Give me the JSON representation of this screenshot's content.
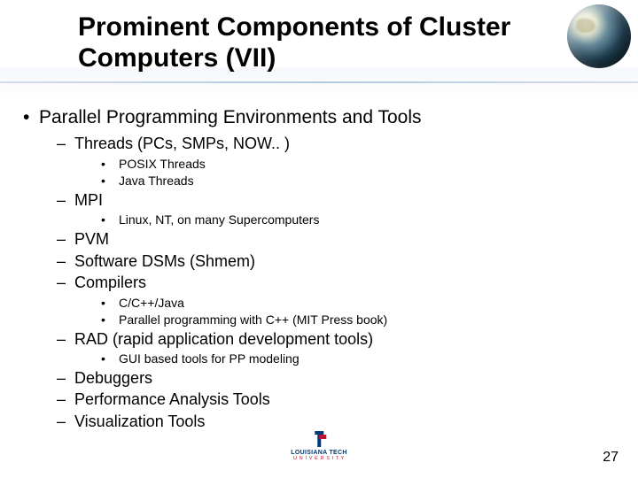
{
  "title": "Prominent Components of Cluster Computers (VII)",
  "content": {
    "heading": "Parallel Programming Environments and Tools",
    "items": [
      {
        "label": "Threads (PCs, SMPs, NOW.. )",
        "sub": [
          "POSIX Threads",
          "Java Threads"
        ]
      },
      {
        "label": "MPI",
        "sub": [
          "Linux, NT, on many Supercomputers"
        ]
      },
      {
        "label": "PVM",
        "sub": []
      },
      {
        "label": "Software DSMs (Shmem)",
        "sub": []
      },
      {
        "label": "Compilers",
        "sub": [
          "C/C++/Java",
          "Parallel programming with C++ (MIT Press book)"
        ]
      },
      {
        "label": "RAD (rapid application development tools)",
        "sub": [
          "GUI based tools for PP modeling"
        ]
      },
      {
        "label": "Debuggers",
        "sub": []
      },
      {
        "label": "Performance Analysis Tools",
        "sub": []
      },
      {
        "label": "Visualization Tools",
        "sub": []
      }
    ]
  },
  "footer": {
    "page": "27",
    "logo_main": "LOUISIANA TECH",
    "logo_sub": "U N I V E R S I T Y"
  }
}
